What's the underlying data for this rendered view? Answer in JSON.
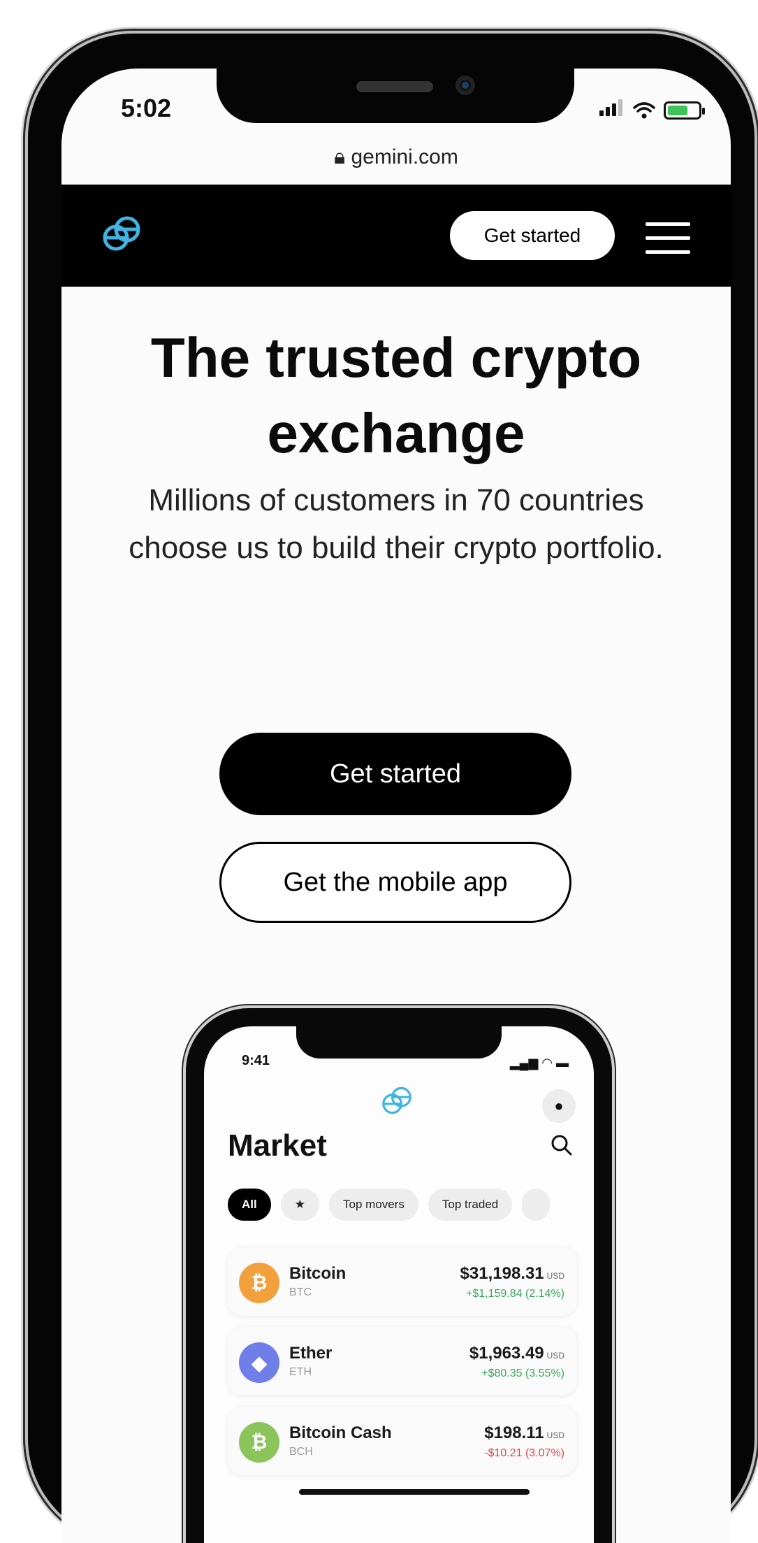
{
  "status": {
    "time": "5:02"
  },
  "browser": {
    "url": "gemini.com"
  },
  "nav": {
    "cta_label": "Get started"
  },
  "hero": {
    "title": "The trusted crypto exchange",
    "subtitle": "Millions of customers in 70 countries choose us to build their crypto portfolio."
  },
  "actions": {
    "primary_label": "Get started",
    "secondary_label": "Get the mobile app"
  },
  "colors": {
    "brand_cyan": "#3fb4e3",
    "positive": "#3aa85a",
    "negative": "#e0454f"
  },
  "mini_app": {
    "time": "9:41",
    "title": "Market",
    "chips": [
      "All",
      "★",
      "Top movers",
      "Top traded"
    ],
    "coins": [
      {
        "name": "Bitcoin",
        "symbol": "BTC",
        "price": "$31,198.31",
        "unit": "USD",
        "change": "+$1,159.84 (2.14%)",
        "color": "#f2a03c",
        "glyph": "₿",
        "trend": "up"
      },
      {
        "name": "Ether",
        "symbol": "ETH",
        "price": "$1,963.49",
        "unit": "USD",
        "change": "+$80.35 (3.55%)",
        "color": "#6f7ee8",
        "glyph": "◆",
        "trend": "up"
      },
      {
        "name": "Bitcoin Cash",
        "symbol": "BCH",
        "price": "$198.11",
        "unit": "USD",
        "change": "-$10.21 (3.07%)",
        "color": "#8ac45a",
        "glyph": "₿",
        "trend": "down"
      }
    ]
  }
}
